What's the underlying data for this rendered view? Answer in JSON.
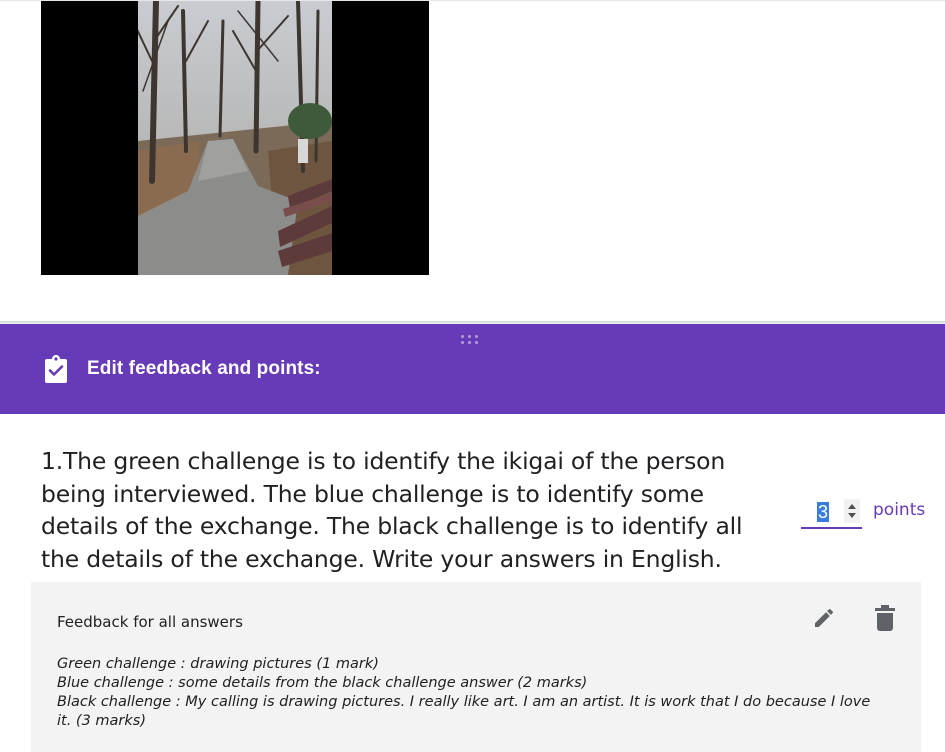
{
  "header": {
    "title": "Edit feedback and points:",
    "icon": "assignment-check-icon",
    "color": "#673ab7"
  },
  "question": {
    "text": "1.The green challenge is to identify the ikigai of the person being interviewed. The blue challenge is to identify some details of the exchange. The black challenge is to identify all the details of the exchange. Write your answers in English."
  },
  "points": {
    "value": "3",
    "label": "points"
  },
  "feedback": {
    "title": "Feedback for all answers",
    "lines": [
      "Green challenge : drawing pictures (1 mark)",
      "Blue challenge : some details from the black challenge answer (2 marks)",
      "Black challenge : My calling is drawing pictures. I really like art. I am an artist. It is work that I do because I love it. (3 marks)"
    ]
  }
}
